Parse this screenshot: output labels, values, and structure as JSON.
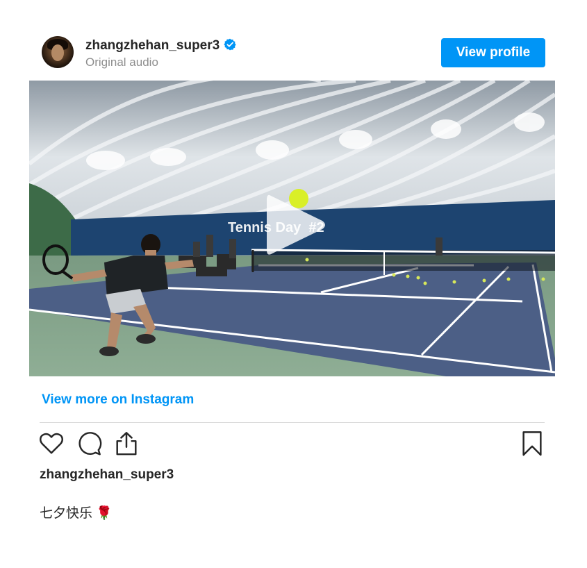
{
  "header": {
    "username": "zhangzhehan_super3",
    "subtitle": "Original audio",
    "view_profile_label": "View profile"
  },
  "media": {
    "overlay_text": "Tennis Day  #2",
    "play_icon": "play-icon"
  },
  "footer": {
    "view_more_label": "View more on Instagram",
    "caption_username": "zhangzhehan_super3",
    "caption_text": "七夕快乐 🌹"
  },
  "icons": {
    "verified": "verified-badge-icon",
    "like": "heart-icon",
    "comment": "comment-icon",
    "share": "share-icon",
    "save": "bookmark-icon"
  },
  "colors": {
    "accent": "#0095f6",
    "text": "#262626",
    "muted": "#8e8e8e",
    "divider": "#dbdbdb"
  }
}
